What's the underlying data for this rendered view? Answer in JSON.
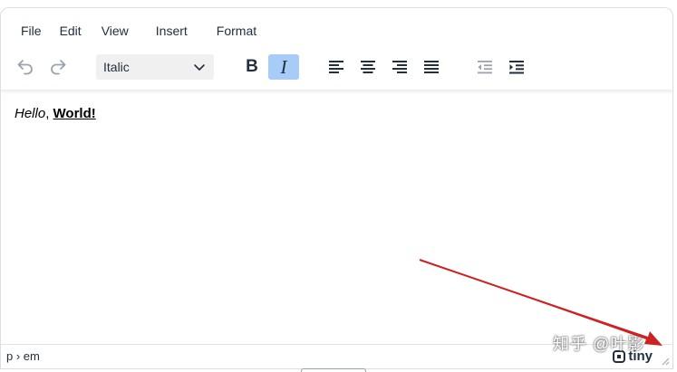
{
  "menubar": {
    "items": [
      {
        "key": "file",
        "label": "File"
      },
      {
        "key": "edit",
        "label": "Edit"
      },
      {
        "key": "view",
        "label": "View"
      },
      {
        "key": "insert",
        "label": "Insert"
      },
      {
        "key": "format",
        "label": "Format"
      }
    ]
  },
  "toolbar": {
    "undo_icon": "undo-icon",
    "redo_icon": "redo-icon",
    "format_select_value": "Italic",
    "bold_label": "B",
    "italic_label": "I",
    "italic_active": true,
    "align_icons": [
      "align-left-icon",
      "align-center-icon",
      "align-right-icon",
      "align-justify-icon"
    ],
    "indent_icons": [
      "outdent-icon",
      "indent-icon"
    ]
  },
  "content": {
    "italic_text": "Hello",
    "separator": ", ",
    "bold_text": "World!"
  },
  "statusbar": {
    "path": "p › em",
    "brand": "tiny"
  },
  "watermark": "知乎 @叶影",
  "colors": {
    "active_button": "#a6ccf7",
    "text": "#222f3e",
    "arrow": "#cc2222"
  }
}
